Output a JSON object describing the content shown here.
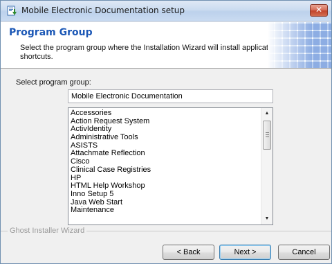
{
  "window": {
    "title": "Mobile Electronic Documentation setup",
    "close_glyph": "✕"
  },
  "header": {
    "title": "Program Group",
    "description": "Select the program group where the Installation Wizard will install application shortcuts."
  },
  "body": {
    "select_label": "Select program group:",
    "group_value": "Mobile Electronic Documentation",
    "program_groups": [
      "Accessories",
      "Action Request System",
      "ActivIdentity",
      "Administrative Tools",
      "ASISTS",
      "Attachmate Reflection",
      "Cisco",
      "Clinical Case Registries",
      "HP",
      "HTML Help Workshop",
      "Inno Setup 5",
      "Java Web Start",
      "Maintenance"
    ],
    "scroll_up_glyph": "▲",
    "scroll_down_glyph": "▼"
  },
  "footer": {
    "label": "Ghost Installer Wizard",
    "back_label": "< Back",
    "next_label": "Next >",
    "cancel_label": "Cancel"
  },
  "colors": {
    "header_title": "#1c58b6",
    "close_button": "#c2442c"
  },
  "icons": {
    "app": "installer-icon",
    "close": "close-icon",
    "scroll_up": "chevron-up-icon",
    "scroll_down": "chevron-down-icon"
  }
}
